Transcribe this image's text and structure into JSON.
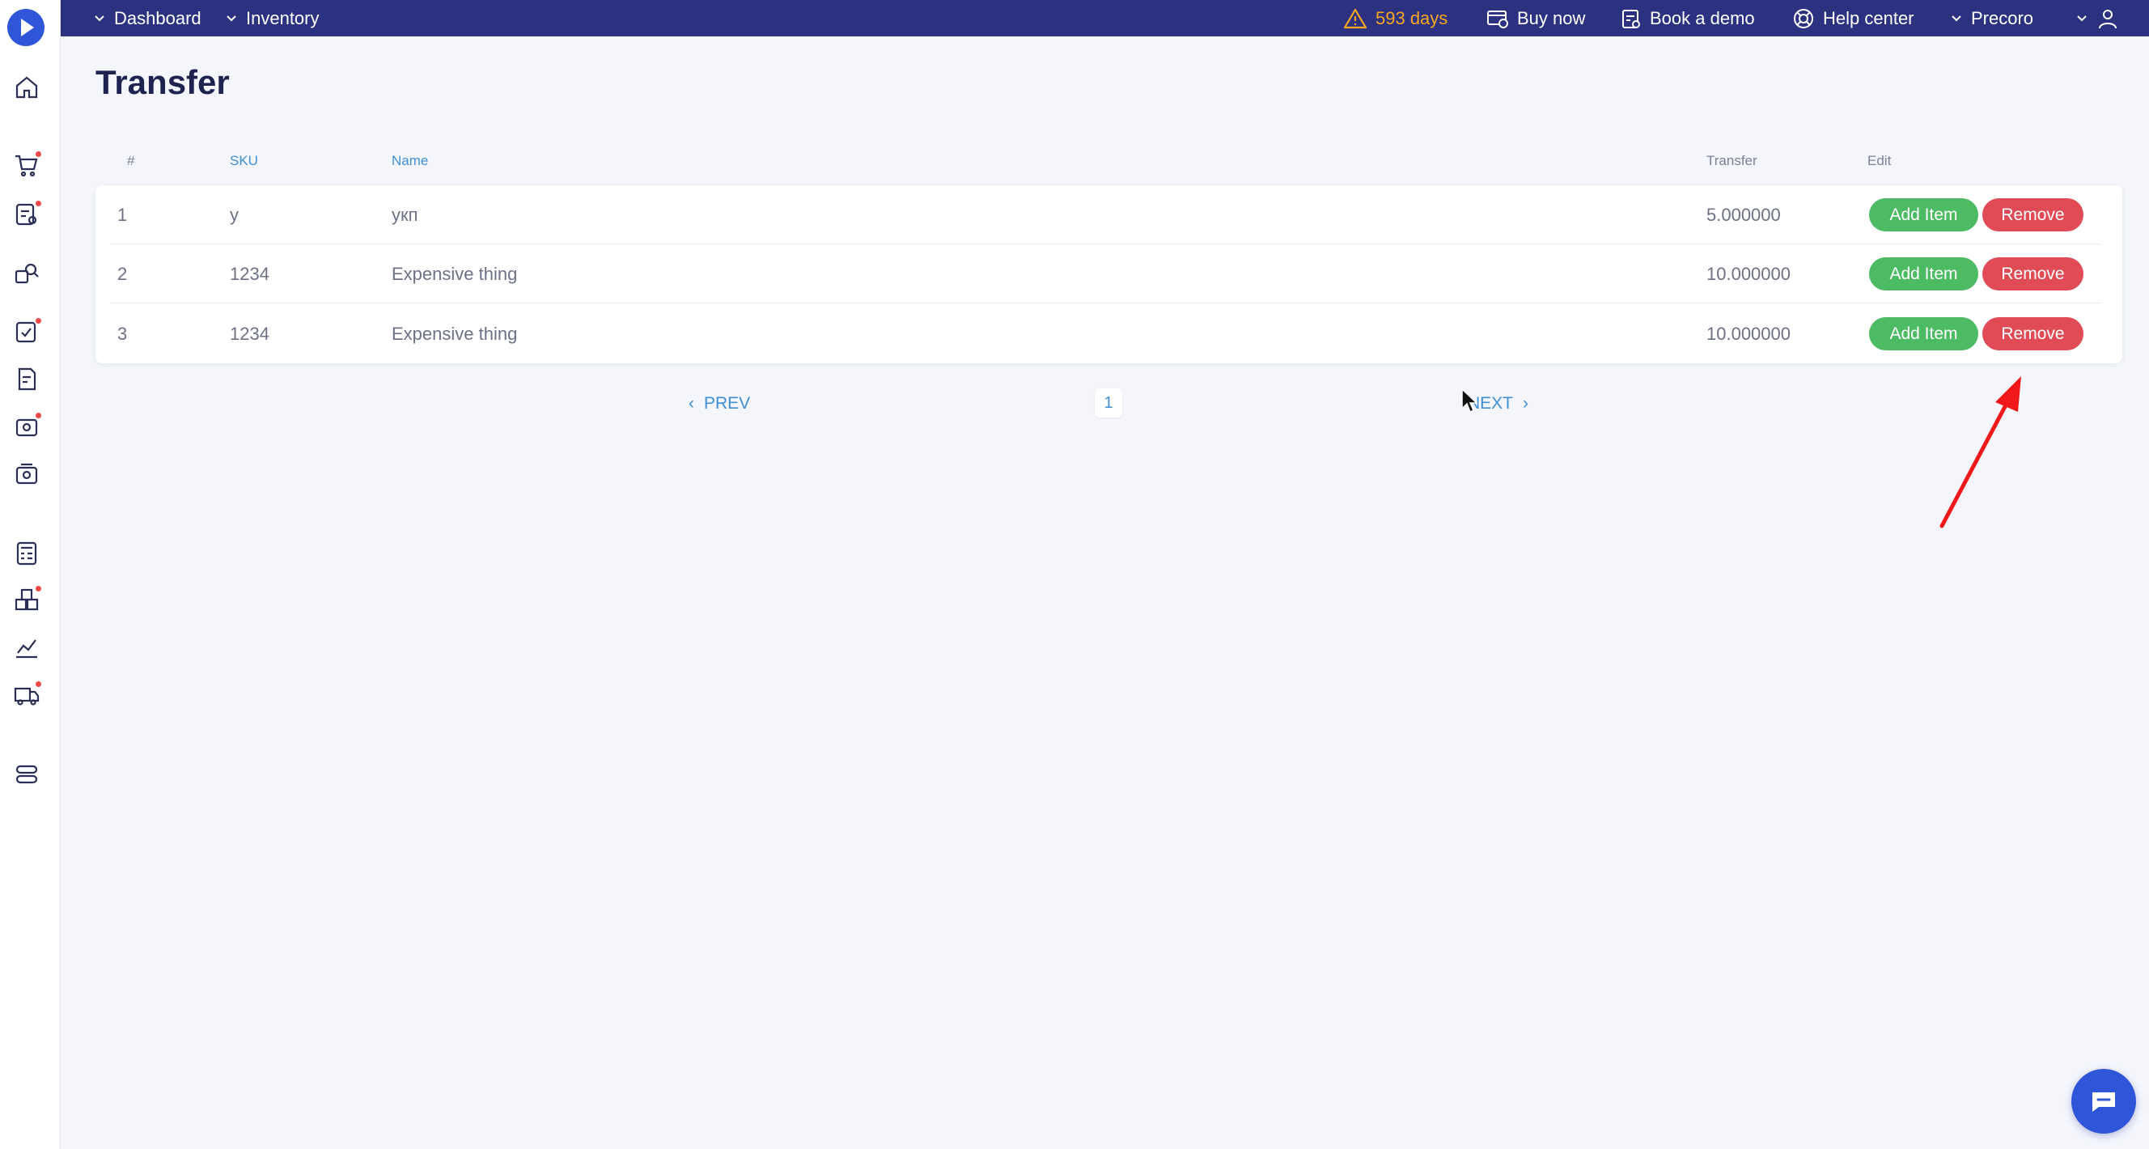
{
  "nav": {
    "breadcrumb": [
      "Dashboard",
      "Inventory"
    ],
    "trial": "593 days",
    "buy_now": "Buy now",
    "book_demo": "Book a demo",
    "help_center": "Help center",
    "company": "Precoro"
  },
  "page": {
    "title": "Transfer"
  },
  "table": {
    "columns": [
      "#",
      "SKU",
      "Name",
      "Transfer",
      "Edit"
    ],
    "rows": [
      {
        "num": "1",
        "sku": "у",
        "name": "укп",
        "transfer": "5.000000"
      },
      {
        "num": "2",
        "sku": "1234",
        "name": "Expensive thing",
        "transfer": "10.000000"
      },
      {
        "num": "3",
        "sku": "1234",
        "name": "Expensive thing",
        "transfer": "10.000000"
      }
    ],
    "add_label": "Add Item",
    "remove_label": "Remove"
  },
  "pagination": {
    "prev": "PREV",
    "current": "1",
    "next": "NEXT"
  },
  "colors": {
    "topbar": "#2d3280",
    "add": "#4dbb63",
    "remove": "#e04b56",
    "link": "#3f8fd4",
    "warning": "#f5a623"
  }
}
